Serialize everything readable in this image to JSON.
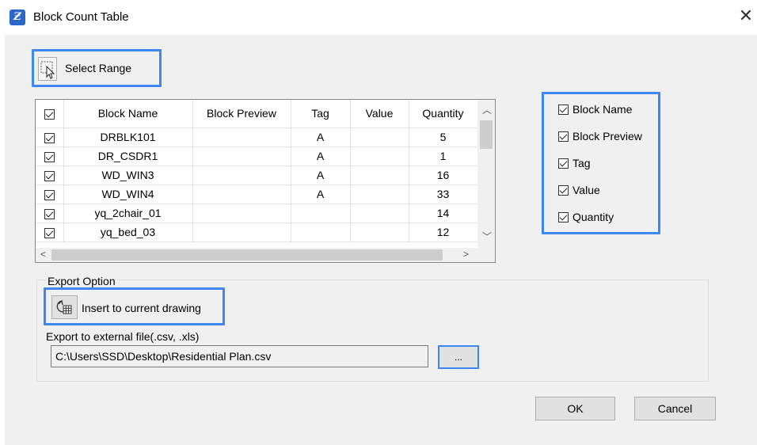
{
  "window": {
    "title": "Block Count Table",
    "close_glyph": "✕"
  },
  "select_range": {
    "label": "Select Range",
    "icon": "select-range-icon"
  },
  "table": {
    "columns": [
      "Block Name",
      "Block Preview",
      "Tag",
      "Value",
      "Quantity"
    ],
    "rows": [
      {
        "checked": true,
        "name": "DRBLK101",
        "preview": "",
        "tag": "A",
        "value": "",
        "quantity": "5"
      },
      {
        "checked": true,
        "name": "DR_CSDR1",
        "preview": "",
        "tag": "A",
        "value": "",
        "quantity": "1"
      },
      {
        "checked": true,
        "name": "WD_WIN3",
        "preview": "",
        "tag": "A",
        "value": "",
        "quantity": "16"
      },
      {
        "checked": true,
        "name": "WD_WIN4",
        "preview": "",
        "tag": "A",
        "value": "",
        "quantity": "33"
      },
      {
        "checked": true,
        "name": "yq_2chair_01",
        "preview": "",
        "tag": "",
        "value": "",
        "quantity": "14"
      },
      {
        "checked": true,
        "name": "yq_bed_03",
        "preview": "",
        "tag": "",
        "value": "",
        "quantity": "12"
      }
    ]
  },
  "column_options": [
    {
      "label": "Block Name",
      "checked": true
    },
    {
      "label": "Block Preview",
      "checked": true
    },
    {
      "label": "Tag",
      "checked": true
    },
    {
      "label": "Value",
      "checked": true
    },
    {
      "label": "Quantity",
      "checked": true
    }
  ],
  "export": {
    "group_label": "Export Option",
    "insert_label": "Insert to current drawing",
    "external_label": "Export to external file(.csv, .xls)",
    "path": "C:\\Users\\SSD\\Desktop\\Residential Plan.csv",
    "browse_label": "..."
  },
  "buttons": {
    "ok": "OK",
    "cancel": "Cancel"
  },
  "colors": {
    "highlight": "#3d86f3",
    "dialog_bg": "#f0f0f0",
    "accent_icon": "#2a67c9"
  }
}
